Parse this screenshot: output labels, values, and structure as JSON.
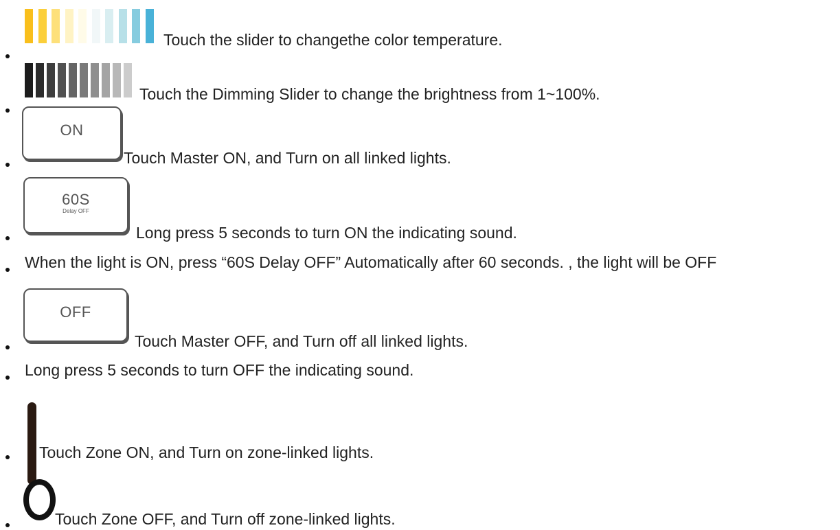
{
  "items": [
    {
      "text": "Touch the slider to changethe color temperature."
    },
    {
      "text": "Touch the Dimming Slider to change the brightness from 1~100%."
    },
    {
      "text": "Touch Master ON, and Turn on all linked lights.",
      "button_label": "ON"
    },
    {
      "text": "Long press 5 seconds to turn ON the indicating sound.",
      "button_label": "60S",
      "button_sublabel": "Delay OFF"
    },
    {
      "text": "When the light is ON, press “60S Delay OFF” Automatically after 60 seconds. , the light will be OFF"
    },
    {
      "text": "Touch Master OFF, and Turn off all linked lights.",
      "button_label": "OFF"
    },
    {
      "text": "Long press 5 seconds to turn OFF the indicating sound."
    },
    {
      "text": "Touch Zone ON, and Turn on zone-linked lights."
    },
    {
      "text": "Touch Zone OFF, and Turn off zone-linked lights."
    }
  ],
  "icons": {
    "color_temperature_slider": [
      "#f9bf1c",
      "#fbcf3a",
      "#fde07a",
      "#fff3c4",
      "#fffbe8",
      "#f1f7f8",
      "#d9eef1",
      "#b7e0e8",
      "#86ccdf",
      "#49b2d8"
    ],
    "dimming_slider": [
      "#1c1c1c",
      "#2c2c2c",
      "#3e3e3e",
      "#515151",
      "#656565",
      "#7a7a7a",
      "#8f8f8f",
      "#a4a4a4",
      "#b8b8b8",
      "#cccccc"
    ]
  }
}
